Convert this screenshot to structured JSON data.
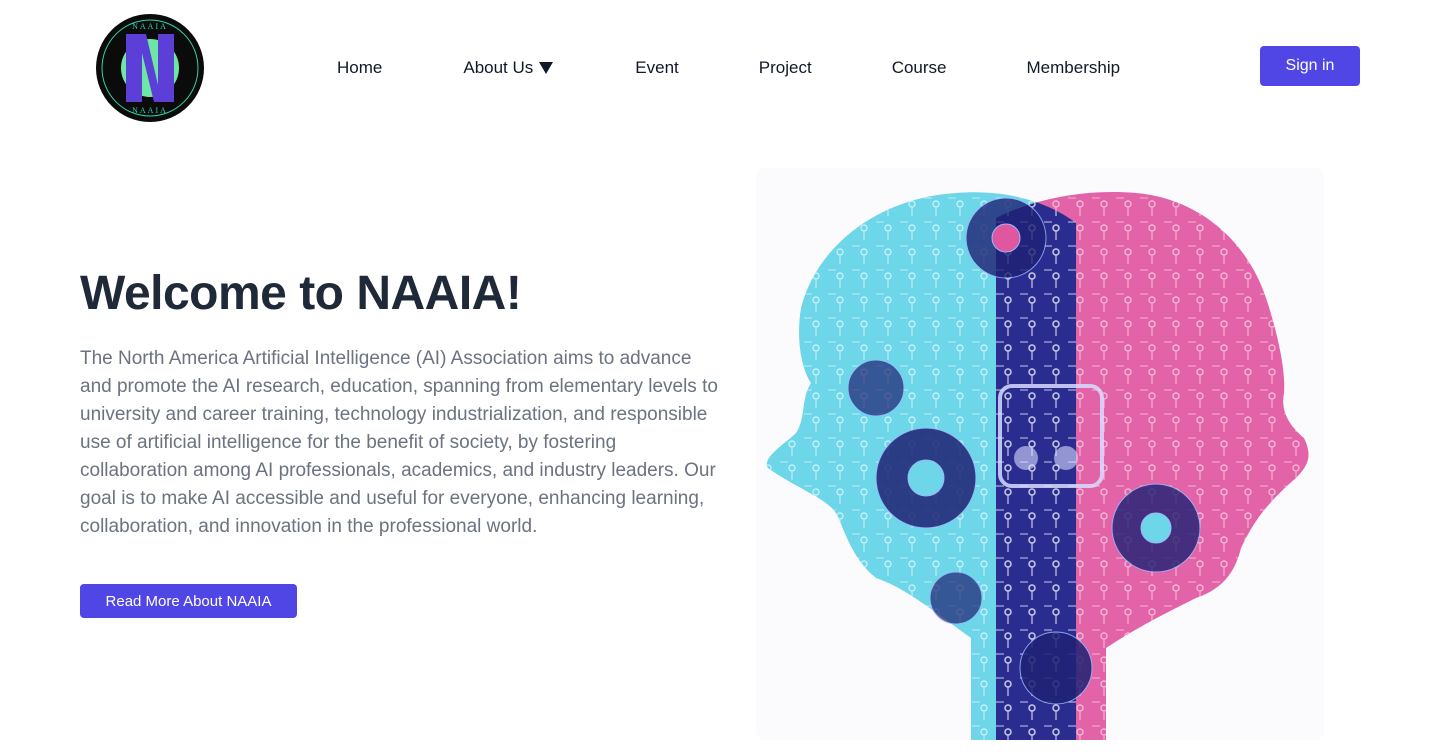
{
  "logo": {
    "top_text": "NAAIA",
    "bottom_text": "NAAIA",
    "colors": {
      "ring": "#0b0b0b",
      "inner": "#10b981",
      "letter": "#5b3fd6"
    }
  },
  "nav": {
    "items": [
      {
        "label": "Home"
      },
      {
        "label": "About Us",
        "has_dropdown": true,
        "icon": "caret-down-icon"
      },
      {
        "label": "Event"
      },
      {
        "label": "Project"
      },
      {
        "label": "Course"
      },
      {
        "label": "Membership"
      }
    ]
  },
  "auth": {
    "signin_label": "Sign in"
  },
  "hero": {
    "title": "Welcome to NAAIA!",
    "description": "The North America Artificial Intelligence (AI) Association aims to advance and promote the AI research, education, spanning from elementary levels to university and career training, technology industrialization, and responsible use of artificial intelligence for the benefit of society, by fostering collaboration among AI professionals, academics, and industry leaders. Our goal is to make AI accessible and useful for everyone, enhancing learning, collaboration, and innovation in the professional world.",
    "cta_label": "Read More About NAAIA",
    "image": {
      "icon": "ai-heads-illustration-icon",
      "colors": {
        "left_head": "#6dd6e8",
        "right_head": "#e0569f",
        "center": "#2a2c8f"
      }
    }
  },
  "theme": {
    "accent": "#4f46e5",
    "title_color": "#1f2937",
    "body_color": "#6b7280"
  }
}
